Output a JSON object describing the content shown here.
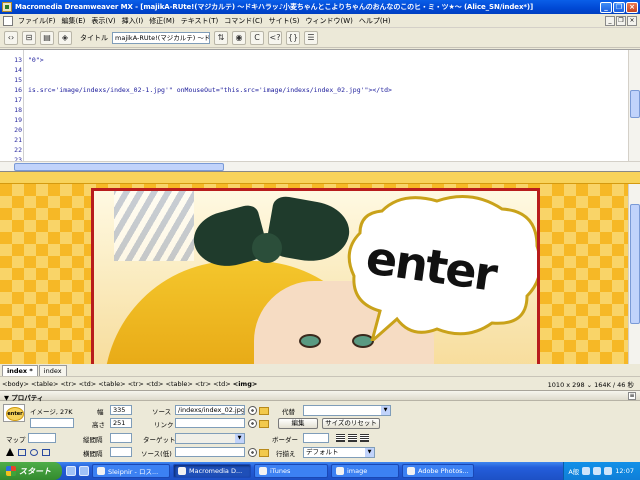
{
  "window": {
    "title": "Macromedia Dreamweaver MX - [majikA-RUte!(マジカルテ) ～ドキハラッ♪小麦ちゃんとこよりちゃんのおんなのこのヒ・ミ・ツ★～ (Alice_SN/index*)]"
  },
  "menu": {
    "items": [
      "ファイル(F)",
      "編集(E)",
      "表示(V)",
      "挿入(I)",
      "修正(M)",
      "テキスト(T)",
      "コマンド(C)",
      "サイト(S)",
      "ウィンドウ(W)",
      "ヘルプ(H)"
    ]
  },
  "toolbar": {
    "title_label": "タイトル",
    "title_value": "majikA-RUte!(マジカルテ) ～ドキ",
    "icons": [
      "code-view-icon",
      "split-view-icon",
      "design-view-icon",
      "preview-icon",
      "file-management-icon",
      "refresh-icon",
      "reference-icon",
      "code-nav-icon",
      "view-options-icon"
    ],
    "glyphs": {
      "refresh": "C",
      "nav": "{}",
      "reference": "<?"
    }
  },
  "code": {
    "lines": [
      {
        "num": "13",
        "text": "\"0\">"
      },
      {
        "num": "14",
        "text": ""
      },
      {
        "num": "15",
        "text": ""
      },
      {
        "num": "16",
        "text": "is.src='image/indexs/index_02-1.jpg'\" onMouseOut=\"this.src='image/indexs/index_02.jpg'\"></td>"
      },
      {
        "num": "17",
        "text": ""
      },
      {
        "num": "18",
        "text": ""
      },
      {
        "num": "19",
        "text": ""
      },
      {
        "num": "20",
        "text": ""
      },
      {
        "num": "21",
        "text": ""
      },
      {
        "num": "22",
        "text": ""
      },
      {
        "num": "23",
        "text": ""
      }
    ]
  },
  "design": {
    "enter_text": "enter"
  },
  "doctabs": [
    "index *",
    "index"
  ],
  "status": {
    "tag_path": "<body> <table> <tr> <td> <table> <tr> <td> <table> <tr> <td> ",
    "tag_selected": "<img>",
    "right": "1010 x 298 ⌄ 164K / 46 秒"
  },
  "properties": {
    "header": "▼ プロパティ",
    "image_label": "イメージ, 27K",
    "width_label": "幅",
    "width_value": "335",
    "height_label": "高さ",
    "height_value": "251",
    "src_label": "ソース",
    "src_value": "/indexs/index_02.jpg",
    "link_label": "リンク",
    "link_value": "",
    "alt_label": "代替",
    "alt_value": "",
    "edit_button": "編集",
    "reset_size_button": "サイズのリセット",
    "map_label": "マップ",
    "vspace_label": "縦間隔",
    "hspace_label": "横間隔",
    "target_label": "ターゲット",
    "lowsrc_label": "ソース(低)",
    "border_label": "ボーダー",
    "align_label": "行揃え",
    "align_value": "デフォルト",
    "thumb_text": "enter"
  },
  "taskbar": {
    "start": "スタート",
    "tasks": [
      {
        "label": "Sleipnir - ロス...",
        "active": false
      },
      {
        "label": "Macromedia D...",
        "active": true
      },
      {
        "label": "iTunes",
        "active": false
      },
      {
        "label": "image",
        "active": false
      },
      {
        "label": "Adobe Photos...",
        "active": false
      }
    ],
    "tray_text": "A般",
    "clock": "12:07"
  },
  "colors": {
    "titlebar": "#0a5ee8",
    "frame_border": "#b81c1c",
    "design_bg": "#f6b826",
    "taskbar": "#245edb",
    "start_button": "#4ead48"
  }
}
